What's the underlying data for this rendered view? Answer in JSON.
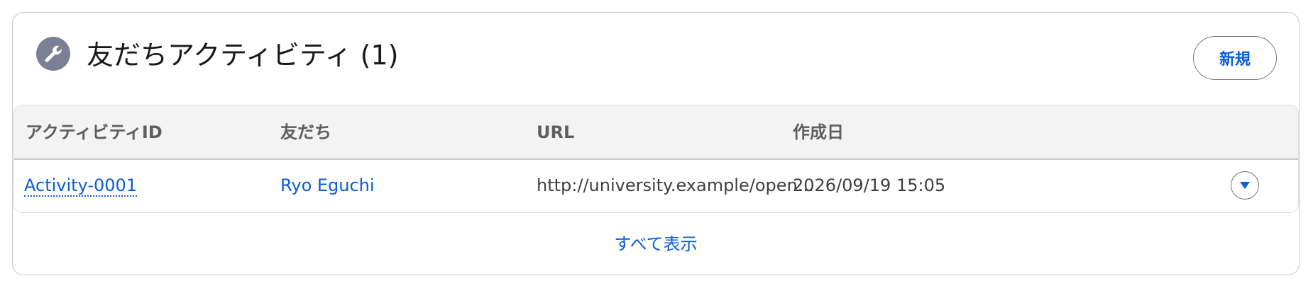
{
  "card": {
    "title": "友だちアクティビティ (1)",
    "icon": "wrench-icon",
    "icon_bg": "#7c8096",
    "new_button_label": "新規",
    "view_all_label": "すべて表示"
  },
  "table": {
    "columns": [
      "アクティビティID",
      "友だち",
      "URL",
      "作成日"
    ],
    "rows": [
      {
        "activity_id": "Activity-0001",
        "friend": "Ryo Eguchi",
        "url": "http://university.example/open...",
        "created": "2026/09/19 15:05"
      }
    ],
    "row_action_icon": "dropdown-circle-icon"
  },
  "colors": {
    "link": "#0b5cd5",
    "header_bg": "#f3f3f3",
    "border": "#c9c9c9"
  }
}
